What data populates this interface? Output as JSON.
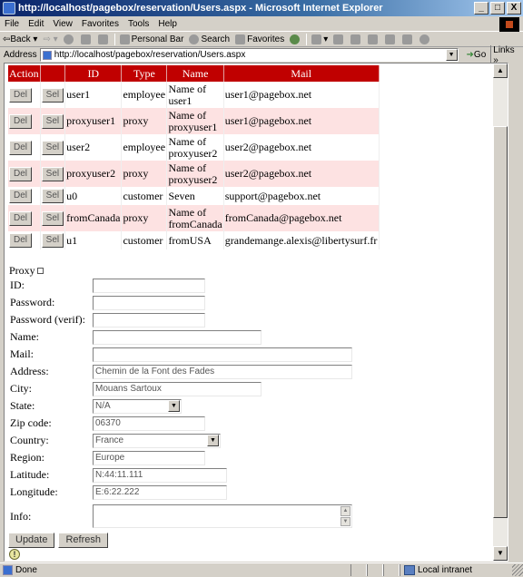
{
  "window": {
    "title": "http://localhost/pagebox/reservation/Users.aspx - Microsoft Internet Explorer",
    "minimize": "_",
    "maximize": "□",
    "close": "X"
  },
  "menu": [
    "File",
    "Edit",
    "View",
    "Favorites",
    "Tools",
    "Help"
  ],
  "toolbar": {
    "back": "Back",
    "personal_bar": "Personal Bar",
    "search": "Search",
    "favorites": "Favorites"
  },
  "address": {
    "label": "Address",
    "url": "http://localhost/pagebox/reservation/Users.aspx",
    "go": "Go",
    "links": "Links »"
  },
  "users_table": {
    "headers": {
      "action": "Action",
      "id": "ID",
      "type": "Type",
      "name": "Name",
      "mail": "Mail"
    },
    "del_label": "Del",
    "sel_label": "Sel",
    "rows": [
      {
        "id": "user1",
        "type": "employee",
        "name": "Name of user1",
        "mail": "user1@pagebox.net"
      },
      {
        "id": "proxyuser1",
        "type": "proxy",
        "name": "Name of proxyuser1",
        "mail": "user1@pagebox.net"
      },
      {
        "id": "user2",
        "type": "employee",
        "name": "Name of proxyuser2",
        "mail": "user2@pagebox.net"
      },
      {
        "id": "proxyuser2",
        "type": "proxy",
        "name": "Name of proxyuser2",
        "mail": "user2@pagebox.net"
      },
      {
        "id": "u0",
        "type": "customer",
        "name": "Seven",
        "mail": "support@pagebox.net"
      },
      {
        "id": "fromCanada",
        "type": "proxy",
        "name": "Name of fromCanada",
        "mail": "fromCanada@pagebox.net"
      },
      {
        "id": "u1",
        "type": "customer",
        "name": "fromUSA",
        "mail": "grandemange.alexis@libertysurf.fr"
      }
    ]
  },
  "form": {
    "proxy_label": "Proxy",
    "proxy_checked": false,
    "fields": {
      "id": {
        "label": "ID:",
        "value": ""
      },
      "password": {
        "label": "Password:",
        "value": ""
      },
      "password_verif": {
        "label": "Password (verif):",
        "value": ""
      },
      "name": {
        "label": "Name:",
        "value": ""
      },
      "mail": {
        "label": "Mail:",
        "value": ""
      },
      "address": {
        "label": "Address:",
        "value": "Chemin de la Font des Fades"
      },
      "city": {
        "label": "City:",
        "value": "Mouans Sartoux"
      },
      "state": {
        "label": "State:",
        "value": "N/A"
      },
      "zip": {
        "label": "Zip code:",
        "value": "06370"
      },
      "country": {
        "label": "Country:",
        "value": "France"
      },
      "region": {
        "label": "Region:",
        "value": "Europe"
      },
      "latitude": {
        "label": "Latitude:",
        "value": "N:44:11.111"
      },
      "longitude": {
        "label": "Longitude:",
        "value": "E:6:22.222"
      },
      "info": {
        "label": "Info:",
        "value": ""
      }
    },
    "update_label": "Update",
    "refresh_label": "Refresh",
    "warning_glyph": "!"
  },
  "status": {
    "text": "Done",
    "zone": "Local intranet"
  }
}
